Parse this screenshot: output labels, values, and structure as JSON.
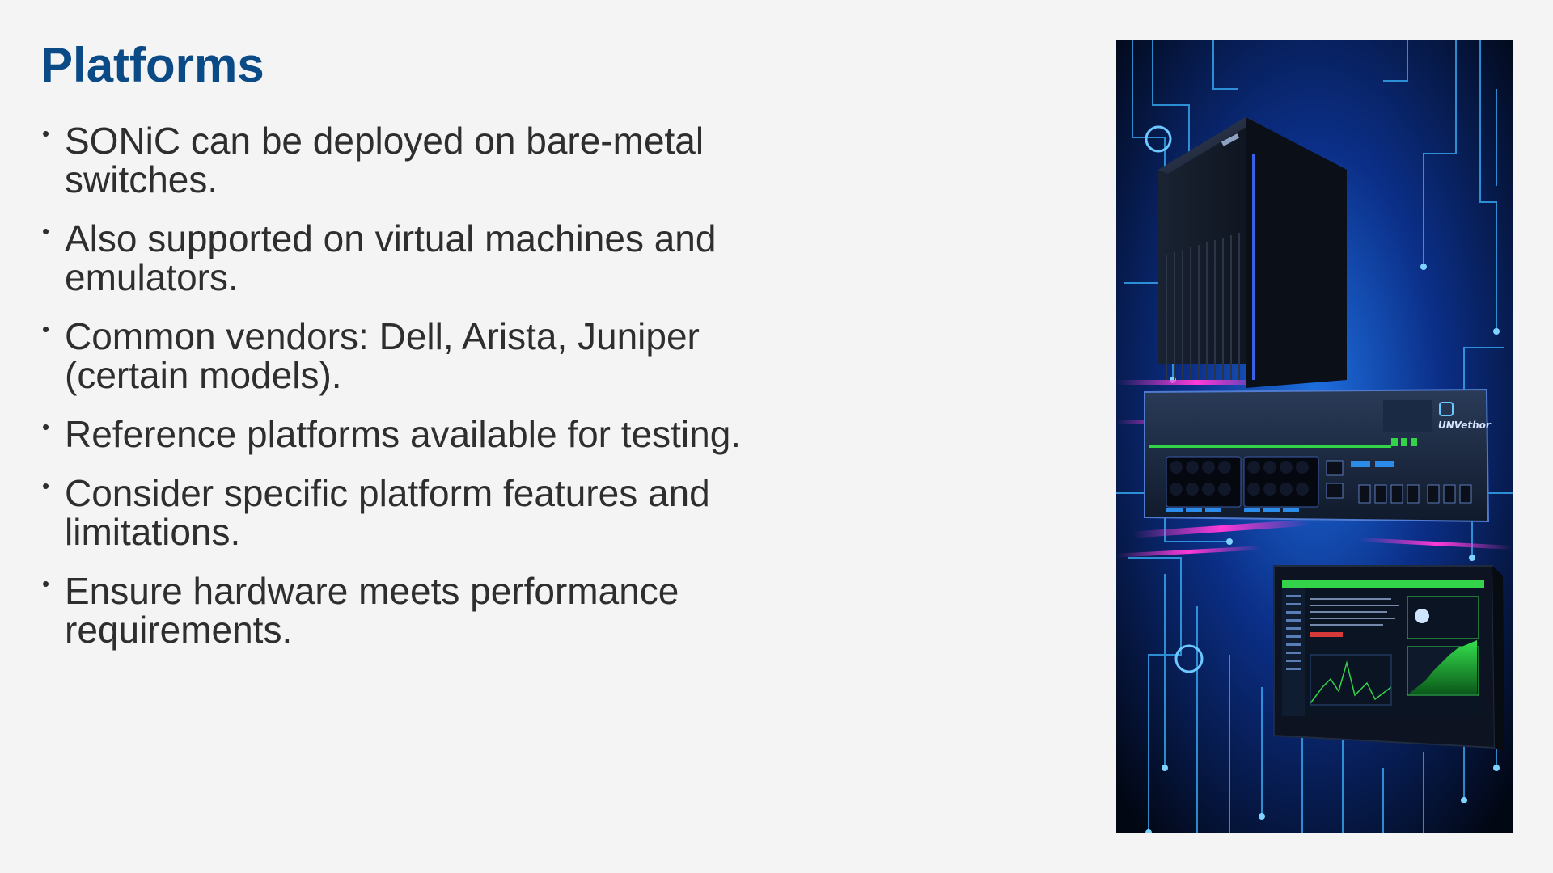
{
  "slide": {
    "title": "Platforms",
    "bullets": [
      "SONiC can be deployed on bare-metal switches.",
      "Also supported on virtual machines and emulators.",
      "Common vendors: Dell, Arista, Juniper (certain models).",
      "Reference platforms available for testing.",
      "Consider specific platform features and limitations.",
      "Ensure hardware meets performance requirements."
    ],
    "bullet_glyph": "•"
  },
  "illustration": {
    "switch_brand": "UNVethor",
    "colors": {
      "title": "#0a4a86",
      "text": "#2e2e2e",
      "circuit_glow": "#2aa8ff",
      "accent_magenta": "#e030d0",
      "screen_green": "#33d44a"
    }
  }
}
